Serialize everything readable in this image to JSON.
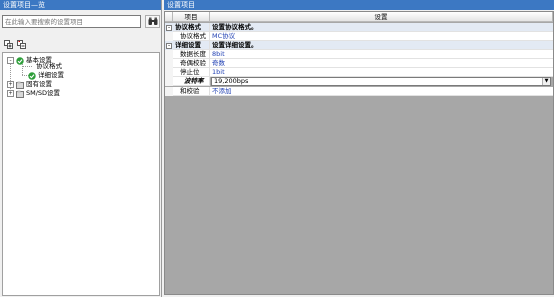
{
  "left_pane": {
    "title": "设置项目—览",
    "search_placeholder": "在此输入要搜索的设置项目",
    "tree": [
      {
        "label": "基本设置"
      },
      {
        "label": "协议格式"
      },
      {
        "label": "详细设置"
      },
      {
        "label": "固有设置"
      },
      {
        "label": "SM/SD设置"
      }
    ]
  },
  "right_pane": {
    "title": "设置项目",
    "col_item": "项目",
    "col_setting": "设置",
    "rows": [
      {
        "item": "协议格式",
        "value": "设置协议格式。"
      },
      {
        "item": "协议格式",
        "value": "MC协议"
      },
      {
        "item": "详细设置",
        "value": "设置详细设置。"
      },
      {
        "item": "数据长度",
        "value": "8bit"
      },
      {
        "item": "奇偶校验",
        "value": "奇数"
      },
      {
        "item": "停止位",
        "value": "1bit"
      },
      {
        "item": "波特率",
        "value": "19,200bps"
      },
      {
        "item": "和校验",
        "value": "不添加"
      }
    ]
  },
  "colors": {
    "title_bar": "#3c78c3",
    "value_text": "#1f3fb3",
    "category_bg": "#e3eaf4"
  }
}
